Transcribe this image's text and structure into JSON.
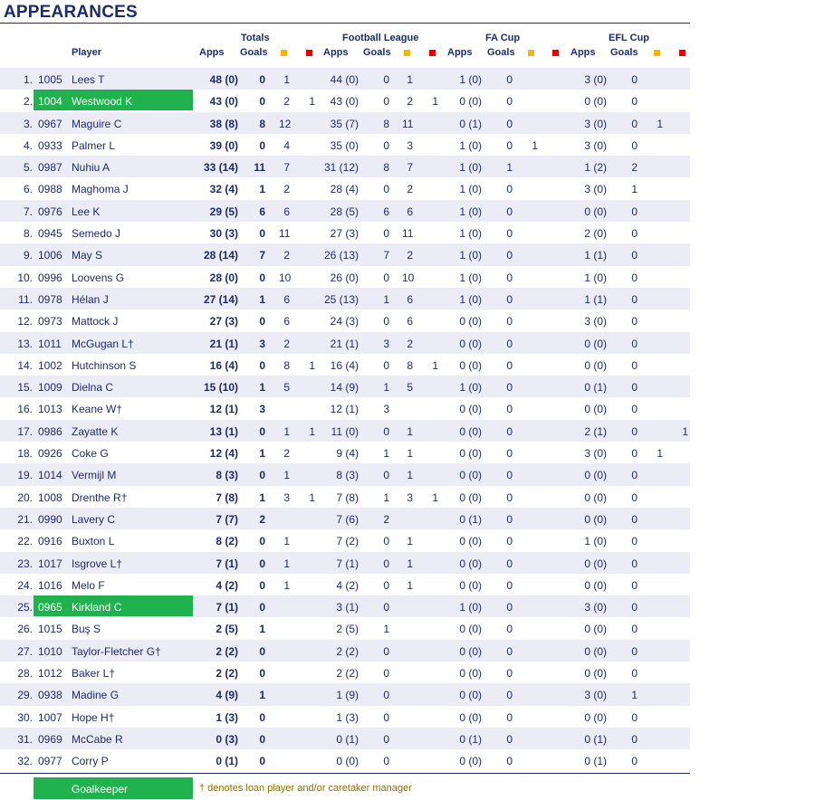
{
  "title": "APPEARANCES",
  "headers": {
    "player": "Player",
    "totals": "Totals",
    "league": "Football League",
    "facup": "FA Cup",
    "eflcup": "EFL Cup",
    "apps": "Apps",
    "goals": "Goals"
  },
  "colors": {
    "yellow": "#f5b800",
    "red": "#e60000",
    "goalkeeper": "#1fb24f",
    "text": "#1f2a6b"
  },
  "rows": [
    {
      "num": "1.",
      "code": "1005",
      "name": "Lees T",
      "t_apps": "48 (0)",
      "t_goals": "0",
      "t_y": "1",
      "t_r": "",
      "l_apps": "44 (0)",
      "l_goals": "0",
      "l_y": "1",
      "l_r": "",
      "f_apps": "1 (0)",
      "f_goals": "0",
      "f_y": "",
      "e_apps": "3 (0)",
      "e_goals": "0",
      "e_y": "",
      "e_r": "",
      "gk": false
    },
    {
      "num": "2.",
      "code": "1004",
      "name": "Westwood K",
      "t_apps": "43 (0)",
      "t_goals": "0",
      "t_y": "2",
      "t_r": "1",
      "l_apps": "43 (0)",
      "l_goals": "0",
      "l_y": "2",
      "l_r": "1",
      "f_apps": "0 (0)",
      "f_goals": "0",
      "f_y": "",
      "e_apps": "0 (0)",
      "e_goals": "0",
      "e_y": "",
      "e_r": "",
      "gk": true
    },
    {
      "num": "3.",
      "code": "0967",
      "name": "Maguire C",
      "t_apps": "38 (8)",
      "t_goals": "8",
      "t_y": "12",
      "t_r": "",
      "l_apps": "35 (7)",
      "l_goals": "8",
      "l_y": "11",
      "l_r": "",
      "f_apps": "0 (1)",
      "f_goals": "0",
      "f_y": "",
      "e_apps": "3 (0)",
      "e_goals": "0",
      "e_y": "1",
      "e_r": "",
      "gk": false
    },
    {
      "num": "4.",
      "code": "0933",
      "name": "Palmer L",
      "t_apps": "39 (0)",
      "t_goals": "0",
      "t_y": "4",
      "t_r": "",
      "l_apps": "35 (0)",
      "l_goals": "0",
      "l_y": "3",
      "l_r": "",
      "f_apps": "1 (0)",
      "f_goals": "0",
      "f_y": "1",
      "e_apps": "3 (0)",
      "e_goals": "0",
      "e_y": "",
      "e_r": "",
      "gk": false
    },
    {
      "num": "5.",
      "code": "0987",
      "name": "Nuhiu A",
      "t_apps": "33 (14)",
      "t_goals": "11",
      "t_y": "7",
      "t_r": "",
      "l_apps": "31 (12)",
      "l_goals": "8",
      "l_y": "7",
      "l_r": "",
      "f_apps": "1 (0)",
      "f_goals": "1",
      "f_y": "",
      "e_apps": "1 (2)",
      "e_goals": "2",
      "e_y": "",
      "e_r": "",
      "gk": false
    },
    {
      "num": "6.",
      "code": "0988",
      "name": "Maghoma J",
      "t_apps": "32 (4)",
      "t_goals": "1",
      "t_y": "2",
      "t_r": "",
      "l_apps": "28 (4)",
      "l_goals": "0",
      "l_y": "2",
      "l_r": "",
      "f_apps": "1 (0)",
      "f_goals": "0",
      "f_y": "",
      "e_apps": "3 (0)",
      "e_goals": "1",
      "e_y": "",
      "e_r": "",
      "gk": false
    },
    {
      "num": "7.",
      "code": "0976",
      "name": "Lee K",
      "t_apps": "29 (5)",
      "t_goals": "6",
      "t_y": "6",
      "t_r": "",
      "l_apps": "28 (5)",
      "l_goals": "6",
      "l_y": "6",
      "l_r": "",
      "f_apps": "1 (0)",
      "f_goals": "0",
      "f_y": "",
      "e_apps": "0 (0)",
      "e_goals": "0",
      "e_y": "",
      "e_r": "",
      "gk": false
    },
    {
      "num": "8.",
      "code": "0945",
      "name": "Semedo J",
      "t_apps": "30 (3)",
      "t_goals": "0",
      "t_y": "11",
      "t_r": "",
      "l_apps": "27 (3)",
      "l_goals": "0",
      "l_y": "11",
      "l_r": "",
      "f_apps": "1 (0)",
      "f_goals": "0",
      "f_y": "",
      "e_apps": "2 (0)",
      "e_goals": "0",
      "e_y": "",
      "e_r": "",
      "gk": false
    },
    {
      "num": "9.",
      "code": "1006",
      "name": "May S",
      "t_apps": "28 (14)",
      "t_goals": "7",
      "t_y": "2",
      "t_r": "",
      "l_apps": "26 (13)",
      "l_goals": "7",
      "l_y": "2",
      "l_r": "",
      "f_apps": "1 (0)",
      "f_goals": "0",
      "f_y": "",
      "e_apps": "1 (1)",
      "e_goals": "0",
      "e_y": "",
      "e_r": "",
      "gk": false
    },
    {
      "num": "10.",
      "code": "0996",
      "name": "Loovens G",
      "t_apps": "28 (0)",
      "t_goals": "0",
      "t_y": "10",
      "t_r": "",
      "l_apps": "26 (0)",
      "l_goals": "0",
      "l_y": "10",
      "l_r": "",
      "f_apps": "1 (0)",
      "f_goals": "0",
      "f_y": "",
      "e_apps": "1 (0)",
      "e_goals": "0",
      "e_y": "",
      "e_r": "",
      "gk": false
    },
    {
      "num": "11.",
      "code": "0978",
      "name": "Hélan J",
      "t_apps": "27 (14)",
      "t_goals": "1",
      "t_y": "6",
      "t_r": "",
      "l_apps": "25 (13)",
      "l_goals": "1",
      "l_y": "6",
      "l_r": "",
      "f_apps": "1 (0)",
      "f_goals": "0",
      "f_y": "",
      "e_apps": "1 (1)",
      "e_goals": "0",
      "e_y": "",
      "e_r": "",
      "gk": false
    },
    {
      "num": "12.",
      "code": "0973",
      "name": "Mattock J",
      "t_apps": "27 (3)",
      "t_goals": "0",
      "t_y": "6",
      "t_r": "",
      "l_apps": "24 (3)",
      "l_goals": "0",
      "l_y": "6",
      "l_r": "",
      "f_apps": "0 (0)",
      "f_goals": "0",
      "f_y": "",
      "e_apps": "3 (0)",
      "e_goals": "0",
      "e_y": "",
      "e_r": "",
      "gk": false
    },
    {
      "num": "13.",
      "code": "1011",
      "name": "McGugan L†",
      "t_apps": "21 (1)",
      "t_goals": "3",
      "t_y": "2",
      "t_r": "",
      "l_apps": "21 (1)",
      "l_goals": "3",
      "l_y": "2",
      "l_r": "",
      "f_apps": "0 (0)",
      "f_goals": "0",
      "f_y": "",
      "e_apps": "0 (0)",
      "e_goals": "0",
      "e_y": "",
      "e_r": "",
      "gk": false
    },
    {
      "num": "14.",
      "code": "1002",
      "name": "Hutchinson S",
      "t_apps": "16 (4)",
      "t_goals": "0",
      "t_y": "8",
      "t_r": "1",
      "l_apps": "16 (4)",
      "l_goals": "0",
      "l_y": "8",
      "l_r": "1",
      "f_apps": "0 (0)",
      "f_goals": "0",
      "f_y": "",
      "e_apps": "0 (0)",
      "e_goals": "0",
      "e_y": "",
      "e_r": "",
      "gk": false
    },
    {
      "num": "15.",
      "code": "1009",
      "name": "Dielna C",
      "t_apps": "15 (10)",
      "t_goals": "1",
      "t_y": "5",
      "t_r": "",
      "l_apps": "14 (9)",
      "l_goals": "1",
      "l_y": "5",
      "l_r": "",
      "f_apps": "1 (0)",
      "f_goals": "0",
      "f_y": "",
      "e_apps": "0 (1)",
      "e_goals": "0",
      "e_y": "",
      "e_r": "",
      "gk": false
    },
    {
      "num": "16.",
      "code": "1013",
      "name": "Keane W†",
      "t_apps": "12 (1)",
      "t_goals": "3",
      "t_y": "",
      "t_r": "",
      "l_apps": "12 (1)",
      "l_goals": "3",
      "l_y": "",
      "l_r": "",
      "f_apps": "0 (0)",
      "f_goals": "0",
      "f_y": "",
      "e_apps": "0 (0)",
      "e_goals": "0",
      "e_y": "",
      "e_r": "",
      "gk": false
    },
    {
      "num": "17.",
      "code": "0986",
      "name": "Zayatte K",
      "t_apps": "13 (1)",
      "t_goals": "0",
      "t_y": "1",
      "t_r": "1",
      "l_apps": "11 (0)",
      "l_goals": "0",
      "l_y": "1",
      "l_r": "",
      "f_apps": "0 (0)",
      "f_goals": "0",
      "f_y": "",
      "e_apps": "2 (1)",
      "e_goals": "0",
      "e_y": "",
      "e_r": "1",
      "gk": false
    },
    {
      "num": "18.",
      "code": "0926",
      "name": "Coke G",
      "t_apps": "12 (4)",
      "t_goals": "1",
      "t_y": "2",
      "t_r": "",
      "l_apps": "9 (4)",
      "l_goals": "1",
      "l_y": "1",
      "l_r": "",
      "f_apps": "0 (0)",
      "f_goals": "0",
      "f_y": "",
      "e_apps": "3 (0)",
      "e_goals": "0",
      "e_y": "1",
      "e_r": "",
      "gk": false
    },
    {
      "num": "19.",
      "code": "1014",
      "name": "Vermijl M",
      "t_apps": "8 (3)",
      "t_goals": "0",
      "t_y": "1",
      "t_r": "",
      "l_apps": "8 (3)",
      "l_goals": "0",
      "l_y": "1",
      "l_r": "",
      "f_apps": "0 (0)",
      "f_goals": "0",
      "f_y": "",
      "e_apps": "0 (0)",
      "e_goals": "0",
      "e_y": "",
      "e_r": "",
      "gk": false
    },
    {
      "num": "20.",
      "code": "1008",
      "name": "Drenthe R†",
      "t_apps": "7 (8)",
      "t_goals": "1",
      "t_y": "3",
      "t_r": "1",
      "l_apps": "7 (8)",
      "l_goals": "1",
      "l_y": "3",
      "l_r": "1",
      "f_apps": "0 (0)",
      "f_goals": "0",
      "f_y": "",
      "e_apps": "0 (0)",
      "e_goals": "0",
      "e_y": "",
      "e_r": "",
      "gk": false
    },
    {
      "num": "21.",
      "code": "0990",
      "name": "Lavery C",
      "t_apps": "7 (7)",
      "t_goals": "2",
      "t_y": "",
      "t_r": "",
      "l_apps": "7 (6)",
      "l_goals": "2",
      "l_y": "",
      "l_r": "",
      "f_apps": "0 (1)",
      "f_goals": "0",
      "f_y": "",
      "e_apps": "0 (0)",
      "e_goals": "0",
      "e_y": "",
      "e_r": "",
      "gk": false
    },
    {
      "num": "22.",
      "code": "0916",
      "name": "Buxton L",
      "t_apps": "8 (2)",
      "t_goals": "0",
      "t_y": "1",
      "t_r": "",
      "l_apps": "7 (2)",
      "l_goals": "0",
      "l_y": "1",
      "l_r": "",
      "f_apps": "0 (0)",
      "f_goals": "0",
      "f_y": "",
      "e_apps": "1 (0)",
      "e_goals": "0",
      "e_y": "",
      "e_r": "",
      "gk": false
    },
    {
      "num": "23.",
      "code": "1017",
      "name": "Isgrove L†",
      "t_apps": "7 (1)",
      "t_goals": "0",
      "t_y": "1",
      "t_r": "",
      "l_apps": "7 (1)",
      "l_goals": "0",
      "l_y": "1",
      "l_r": "",
      "f_apps": "0 (0)",
      "f_goals": "0",
      "f_y": "",
      "e_apps": "0 (0)",
      "e_goals": "0",
      "e_y": "",
      "e_r": "",
      "gk": false
    },
    {
      "num": "24.",
      "code": "1016",
      "name": "Melo F",
      "t_apps": "4 (2)",
      "t_goals": "0",
      "t_y": "1",
      "t_r": "",
      "l_apps": "4 (2)",
      "l_goals": "0",
      "l_y": "1",
      "l_r": "",
      "f_apps": "0 (0)",
      "f_goals": "0",
      "f_y": "",
      "e_apps": "0 (0)",
      "e_goals": "0",
      "e_y": "",
      "e_r": "",
      "gk": false
    },
    {
      "num": "25.",
      "code": "0965",
      "name": "Kirkland C",
      "t_apps": "7 (1)",
      "t_goals": "0",
      "t_y": "",
      "t_r": "",
      "l_apps": "3 (1)",
      "l_goals": "0",
      "l_y": "",
      "l_r": "",
      "f_apps": "1 (0)",
      "f_goals": "0",
      "f_y": "",
      "e_apps": "3 (0)",
      "e_goals": "0",
      "e_y": "",
      "e_r": "",
      "gk": true
    },
    {
      "num": "26.",
      "code": "1015",
      "name": "Buş S",
      "t_apps": "2 (5)",
      "t_goals": "1",
      "t_y": "",
      "t_r": "",
      "l_apps": "2 (5)",
      "l_goals": "1",
      "l_y": "",
      "l_r": "",
      "f_apps": "0 (0)",
      "f_goals": "0",
      "f_y": "",
      "e_apps": "0 (0)",
      "e_goals": "0",
      "e_y": "",
      "e_r": "",
      "gk": false
    },
    {
      "num": "27.",
      "code": "1010",
      "name": "Taylor-Fletcher G†",
      "t_apps": "2 (2)",
      "t_goals": "0",
      "t_y": "",
      "t_r": "",
      "l_apps": "2 (2)",
      "l_goals": "0",
      "l_y": "",
      "l_r": "",
      "f_apps": "0 (0)",
      "f_goals": "0",
      "f_y": "",
      "e_apps": "0 (0)",
      "e_goals": "0",
      "e_y": "",
      "e_r": "",
      "gk": false
    },
    {
      "num": "28.",
      "code": "1012",
      "name": "Baker L†",
      "t_apps": "2 (2)",
      "t_goals": "0",
      "t_y": "",
      "t_r": "",
      "l_apps": "2 (2)",
      "l_goals": "0",
      "l_y": "",
      "l_r": "",
      "f_apps": "0 (0)",
      "f_goals": "0",
      "f_y": "",
      "e_apps": "0 (0)",
      "e_goals": "0",
      "e_y": "",
      "e_r": "",
      "gk": false
    },
    {
      "num": "29.",
      "code": "0938",
      "name": "Madine G",
      "t_apps": "4 (9)",
      "t_goals": "1",
      "t_y": "",
      "t_r": "",
      "l_apps": "1 (9)",
      "l_goals": "0",
      "l_y": "",
      "l_r": "",
      "f_apps": "0 (0)",
      "f_goals": "0",
      "f_y": "",
      "e_apps": "3 (0)",
      "e_goals": "1",
      "e_y": "",
      "e_r": "",
      "gk": false
    },
    {
      "num": "30.",
      "code": "1007",
      "name": "Hope H†",
      "t_apps": "1 (3)",
      "t_goals": "0",
      "t_y": "",
      "t_r": "",
      "l_apps": "1 (3)",
      "l_goals": "0",
      "l_y": "",
      "l_r": "",
      "f_apps": "0 (0)",
      "f_goals": "0",
      "f_y": "",
      "e_apps": "0 (0)",
      "e_goals": "0",
      "e_y": "",
      "e_r": "",
      "gk": false
    },
    {
      "num": "31.",
      "code": "0969",
      "name": "McCabe R",
      "t_apps": "0 (3)",
      "t_goals": "0",
      "t_y": "",
      "t_r": "",
      "l_apps": "0 (1)",
      "l_goals": "0",
      "l_y": "",
      "l_r": "",
      "f_apps": "0 (1)",
      "f_goals": "0",
      "f_y": "",
      "e_apps": "0 (1)",
      "e_goals": "0",
      "e_y": "",
      "e_r": "",
      "gk": false
    },
    {
      "num": "32.",
      "code": "0977",
      "name": "Corry P",
      "t_apps": "0 (1)",
      "t_goals": "0",
      "t_y": "",
      "t_r": "",
      "l_apps": "0 (0)",
      "l_goals": "0",
      "l_y": "",
      "l_r": "",
      "f_apps": "0 (0)",
      "f_goals": "0",
      "f_y": "",
      "e_apps": "0 (1)",
      "e_goals": "0",
      "e_y": "",
      "e_r": "",
      "gk": false
    }
  ],
  "legend": {
    "goalkeeper": "Goalkeeper",
    "note": "† denotes loan player and/or caretaker manager"
  }
}
